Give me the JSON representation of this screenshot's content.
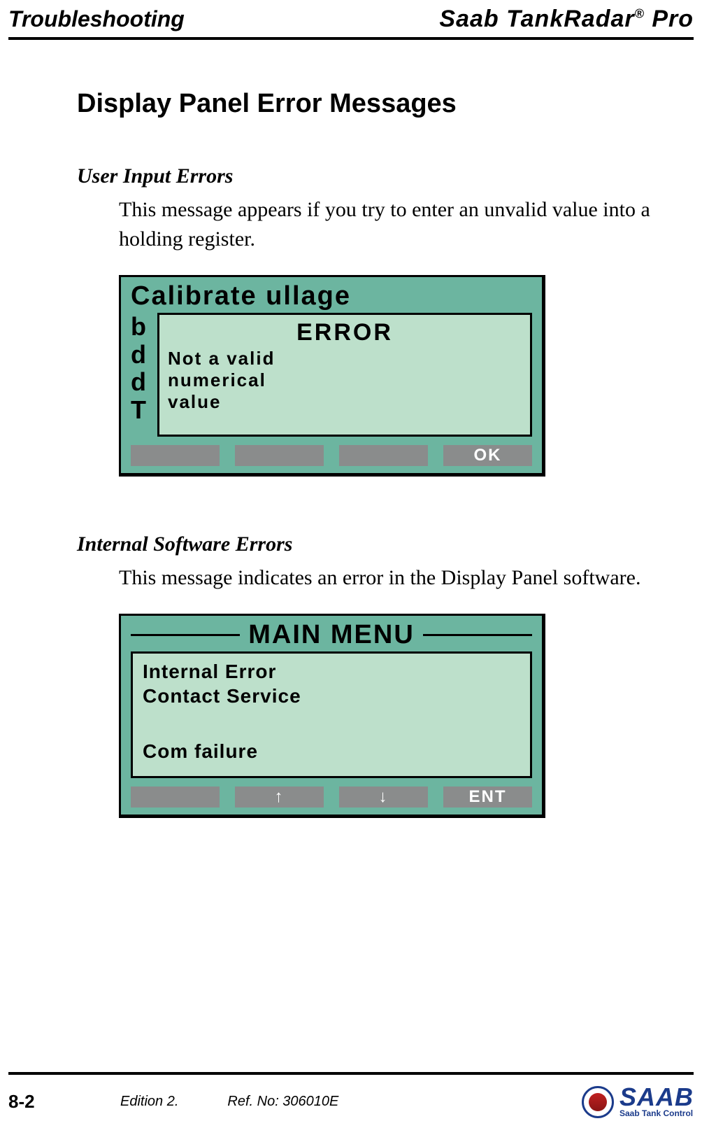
{
  "header": {
    "left": "Troubleshooting",
    "right_prefix": "Saab TankRadar",
    "right_sup": "®",
    "right_suffix": " Pro"
  },
  "title": "Display Panel Error Messages",
  "section1": {
    "heading": "User Input Errors",
    "paragraph": "This message appears if you try to enter an unvalid value into a holding register."
  },
  "lcd1": {
    "title": "Calibrate ullage",
    "sidecol": [
      "b",
      "d",
      "d",
      "T"
    ],
    "popup_title": "ERROR",
    "popup_lines": [
      "Not a valid",
      "numerical",
      "value"
    ],
    "buttons": [
      "",
      "",
      "",
      "OK"
    ]
  },
  "section2": {
    "heading": "Internal Software Errors",
    "paragraph": "This message indicates an error in the Display Panel software."
  },
  "lcd2": {
    "title": "MAIN MENU",
    "popup_lines": [
      "Internal Error",
      "Contact Service"
    ],
    "popup_footer": "Com failure",
    "buttons": [
      "",
      "↑",
      "↓",
      "ENT"
    ]
  },
  "footer": {
    "page": "8-2",
    "edition": "Edition 2.",
    "ref": "Ref. No: 306010E",
    "logo_main": "SAAB",
    "logo_sub": "Saab Tank Control"
  }
}
